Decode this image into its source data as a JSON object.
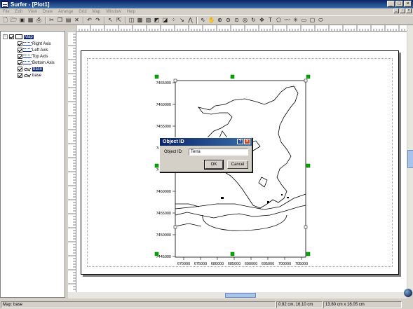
{
  "window": {
    "title": "Surfer - [Plot1]",
    "controls": [
      "_",
      "□",
      "×"
    ]
  },
  "menu": {
    "items": [
      "File",
      "Edit",
      "View",
      "Draw",
      "Arrange",
      "Grid",
      "Map",
      "Window",
      "Help"
    ]
  },
  "object_manager": {
    "items": [
      {
        "label": "Map",
        "selected": true
      },
      {
        "label": "Right Axis"
      },
      {
        "label": "Left Axis"
      },
      {
        "label": "Top Axis"
      },
      {
        "label": "Bottom Axis"
      },
      {
        "label": "base",
        "selected": true
      },
      {
        "label": "base"
      }
    ]
  },
  "map": {
    "y_ticks": [
      "7465000",
      "7460000",
      "7455000",
      "7450000",
      "7445000",
      "7460000",
      "7455000",
      "7450000",
      "7445000"
    ],
    "x_ticks": [
      "670000",
      "675000",
      "680000",
      "685000",
      "690000",
      "695000",
      "700000",
      "705000"
    ]
  },
  "dialog": {
    "title": "Object ID",
    "help": "?",
    "close": "×",
    "label": "Object ID:",
    "value": "Terra",
    "ok": "OK",
    "cancel": "Cancel"
  },
  "status": {
    "left": "Map: base",
    "coords": "0.82 cm, 16.10 cm",
    "size": "13.80 cm x 16.05 cm"
  }
}
